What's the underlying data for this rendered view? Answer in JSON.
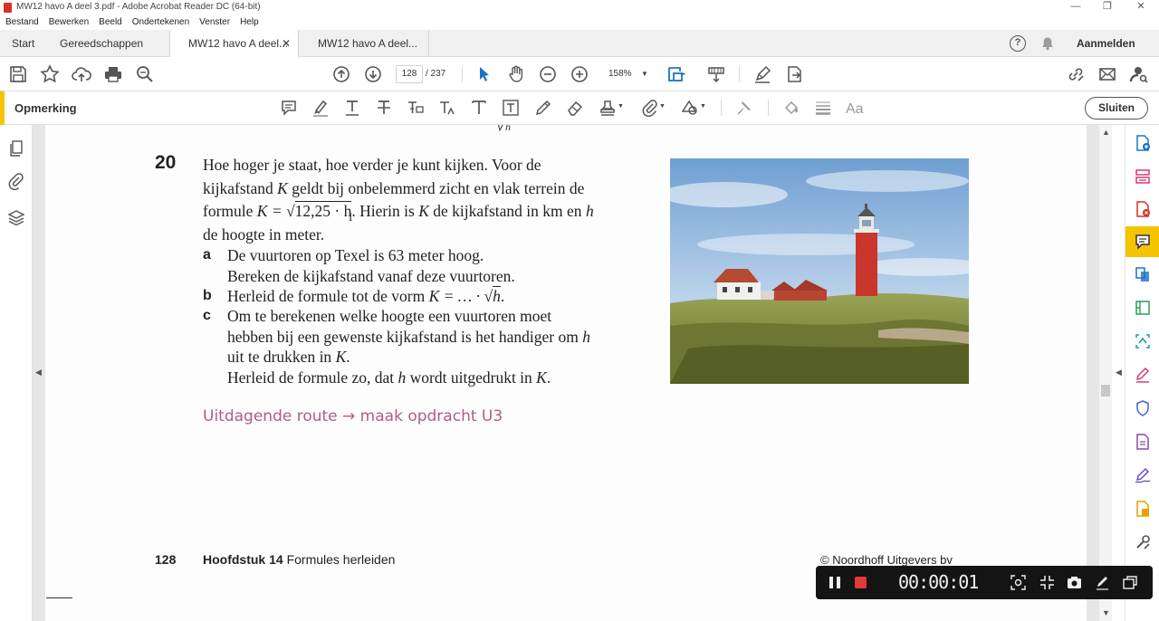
{
  "window": {
    "title": "MW12 havo A deel 3.pdf - Adobe Acrobat Reader DC (64-bit)",
    "controls": {
      "minimize": "—",
      "restore": "❐",
      "close": "✕"
    }
  },
  "menu": [
    "Bestand",
    "Bewerken",
    "Beeld",
    "Ondertekenen",
    "Venster",
    "Help"
  ],
  "tabs": {
    "home": "Start",
    "tools": "Gereedschappen",
    "doc_active": "MW12 havo A deel...",
    "doc_other": "MW12 havo A deel...",
    "close_glyph": "✕",
    "help_glyph": "?",
    "signin": "Aanmelden"
  },
  "toolbar": {
    "page_current": "128",
    "page_total": "/ 237",
    "zoom": "158%"
  },
  "comment_bar": {
    "label": "Opmerking",
    "close": "Sluiten"
  },
  "nav": {
    "left_arrow": "◀",
    "right_arrow": "◀",
    "scroll_up": "▲",
    "scroll_down": "▼"
  },
  "document": {
    "question_number": "20",
    "intro": {
      "line1": "Hoe hoger je staat, hoe verder je kunt kijken. Voor de",
      "line2a": "kijkafstand ",
      "var_k": "K",
      "line2b": " geldt bij onbelemmerd zicht en vlak terrein de",
      "line3a": "formule ",
      "formula_lhs": "K = √",
      "formula_radicand": "12,25 · h",
      "line3b": ". Hierin is ",
      "line3c": " de kijkafstand in km en ",
      "var_h": "h",
      "line4": "de hoogte in meter."
    },
    "parts": [
      {
        "label": "a",
        "text": "De vuurtoren op Texel is 63 meter hoog.",
        "text2": "Bereken de kijkafstand vanaf deze vuurtoren."
      },
      {
        "label": "b",
        "text_a": "Herleid de formule tot de vorm ",
        "text_formula": "K = … · √",
        "text_h": "h",
        "text_end": "."
      },
      {
        "label": "c",
        "l1": "Om te berekenen welke hoogte een vuurtoren moet",
        "l2a": "hebben bij een gewenste kijkafstand is het handiger om ",
        "l3a": "uit te drukken in ",
        "l3b": ".",
        "l4a": "Herleid de formule zo, dat ",
        "l4b": " wordt uitgedrukt in ",
        "l4c": "."
      }
    ],
    "route": "Uitdagende route → maak opdracht U3",
    "footer": {
      "page": "128",
      "chapter_bold": "Hoofdstuk 14",
      "chapter": " Formules herleiden",
      "copyright": "© Noordhoff Uitgevers bv"
    }
  },
  "recorder": {
    "time": "00:00:01"
  },
  "colors": {
    "accent_yellow": "#f5c400",
    "route_pink": "#b05c86",
    "recorder_stop": "#e53935",
    "lighthouse_red": "#c9372c"
  }
}
